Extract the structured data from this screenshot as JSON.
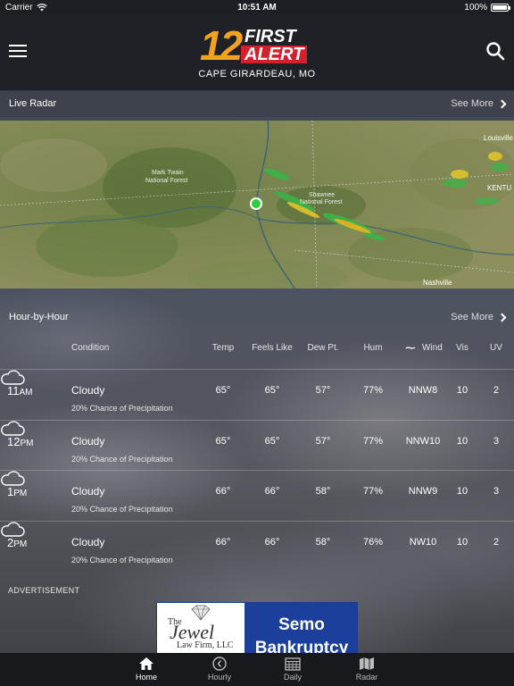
{
  "status_bar": {
    "carrier": "Carrier",
    "time": "10:51 AM",
    "battery": "100%"
  },
  "header": {
    "logo_number": "12",
    "logo_first": "FIRST",
    "logo_alert": "ALERT",
    "location": "CAPE GIRARDEAU, MO"
  },
  "radar": {
    "title": "Live Radar",
    "see_more": "See More",
    "map_labels": {
      "mark_twain": "Mark Twain",
      "national_forest_1": "National Forest",
      "shawnee": "Shawnee",
      "national_forest_2": "National Forest",
      "louisville": "Louisville",
      "kentucky": "KENTU",
      "nashville": "Nashville"
    }
  },
  "hourly": {
    "title": "Hour-by-Hour",
    "see_more": "See More",
    "columns": {
      "condition": "Condition",
      "temp": "Temp",
      "feels": "Feels Like",
      "dew": "Dew Pt.",
      "hum": "Hum",
      "wind": "Wind",
      "vis": "Vis",
      "uv": "UV"
    },
    "rows": [
      {
        "hour": "11",
        "ampm": "AM",
        "condition": "Cloudy",
        "precip": "20% Chance of Precipitation",
        "temp": "65°",
        "feels": "65°",
        "dew": "57°",
        "hum": "77%",
        "wind": "NNW8",
        "vis": "10",
        "uv": "2"
      },
      {
        "hour": "12",
        "ampm": "PM",
        "condition": "Cloudy",
        "precip": "20% Chance of Precipitation",
        "temp": "65°",
        "feels": "65°",
        "dew": "57°",
        "hum": "77%",
        "wind": "NNW10",
        "vis": "10",
        "uv": "3"
      },
      {
        "hour": "1",
        "ampm": "PM",
        "condition": "Cloudy",
        "precip": "20% Chance of Precipitation",
        "temp": "66°",
        "feels": "66°",
        "dew": "58°",
        "hum": "77%",
        "wind": "NNW9",
        "vis": "10",
        "uv": "3"
      },
      {
        "hour": "2",
        "ampm": "PM",
        "condition": "Cloudy",
        "precip": "20% Chance of Precipitation",
        "temp": "66°",
        "feels": "66°",
        "dew": "58°",
        "hum": "76%",
        "wind": "NW10",
        "vis": "10",
        "uv": "2"
      }
    ]
  },
  "advertisement": {
    "label": "ADVERTISEMENT",
    "the": "The",
    "jewel": "Jewel",
    "law_firm": "Law Firm, LLC",
    "semo": "Semo",
    "bankruptcy": "Bankruptcy"
  },
  "tabs": [
    {
      "label": "Home",
      "icon": "home-icon",
      "active": true
    },
    {
      "label": "Hourly",
      "icon": "clock-icon",
      "active": false
    },
    {
      "label": "Daily",
      "icon": "calendar-icon",
      "active": false
    },
    {
      "label": "Radar",
      "icon": "map-icon",
      "active": false
    }
  ],
  "colors": {
    "logo_orange": "#f2a31b",
    "logo_red": "#d4202a",
    "ad_blue": "#1c3f9b",
    "radar_location_dot": "#2ecc40"
  }
}
